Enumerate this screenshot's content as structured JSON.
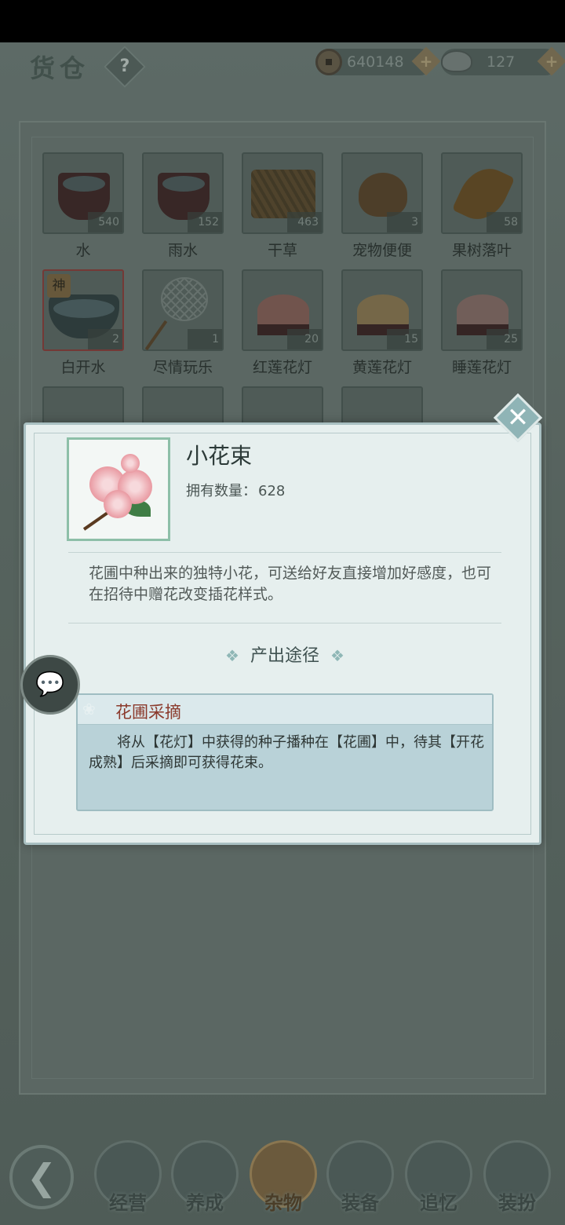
{
  "header": {
    "title": "货仓",
    "help_label": "?",
    "copper_amount": "640148",
    "silver_amount": "127",
    "plus_label": "+"
  },
  "inventory": [
    {
      "name": "水",
      "qty": "540",
      "art": "bucket"
    },
    {
      "name": "雨水",
      "qty": "152",
      "art": "bucket"
    },
    {
      "name": "干草",
      "qty": "463",
      "art": "hay"
    },
    {
      "name": "宠物便便",
      "qty": "3",
      "art": "poop"
    },
    {
      "name": "果树落叶",
      "qty": "58",
      "art": "leaf"
    },
    {
      "name": "白开水",
      "qty": "2",
      "art": "bowl",
      "badge": "神"
    },
    {
      "name": "尽情玩乐",
      "qty": "1",
      "art": "net"
    },
    {
      "name": "红莲花灯",
      "qty": "20",
      "art": "lotus-red"
    },
    {
      "name": "黄莲花灯",
      "qty": "15",
      "art": "lotus-yellow"
    },
    {
      "name": "睡莲花灯",
      "qty": "25",
      "art": "lotus-white"
    }
  ],
  "detail": {
    "close_label": "✕",
    "item_name": "小花束",
    "count_label": "拥有数量：",
    "count_value": "628",
    "description": "花圃中种出来的独特小花，可送给好友直接增加好感度，也可在招待中赠花改变插花样式。",
    "source_heading": "产出途径",
    "source_diamond": "❖",
    "source_title": "花圃采摘",
    "source_text": "将从【花灯】中获得的种子播种在【花圃】中，待其【开花成熟】后采摘即可获得花束。"
  },
  "chat": {
    "icon_label": "💬"
  },
  "nav": {
    "back_label": "❮",
    "items": [
      {
        "label": "经营",
        "active": false
      },
      {
        "label": "养成",
        "active": false
      },
      {
        "label": "杂物",
        "active": true
      },
      {
        "label": "装备",
        "active": false
      },
      {
        "label": "追忆",
        "active": false
      },
      {
        "label": "装扮",
        "active": false
      }
    ]
  },
  "colors": {
    "dialog_bg": "#e6efee",
    "source_title": "#8b3a2c",
    "thumb_border": "#8dbfa8"
  }
}
